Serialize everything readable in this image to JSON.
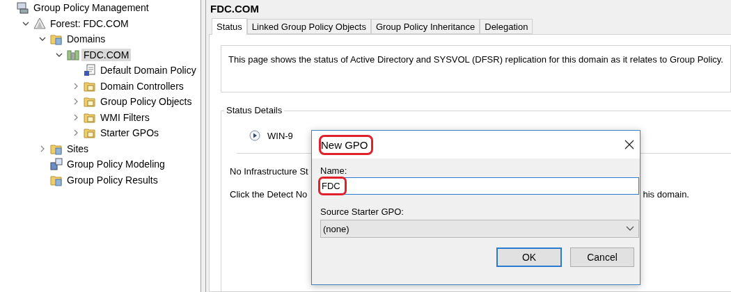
{
  "tree": [
    {
      "label": "Group Policy Management",
      "kind": "console",
      "selected": false,
      "children": [
        {
          "label": "Forest: FDC.COM",
          "kind": "forest",
          "selected": false,
          "expanded": true,
          "children": [
            {
              "label": "Domains",
              "kind": "container",
              "selected": false,
              "expanded": true,
              "children": [
                {
                  "label": "FDC.COM",
                  "kind": "domain",
                  "selected": true,
                  "expanded": true,
                  "children": [
                    {
                      "label": "Default Domain Policy",
                      "kind": "policy",
                      "selected": false
                    },
                    {
                      "label": "Domain Controllers",
                      "kind": "folder",
                      "selected": false,
                      "expanded": false
                    },
                    {
                      "label": "Group Policy Objects",
                      "kind": "folder",
                      "selected": false,
                      "expanded": false
                    },
                    {
                      "label": "WMI Filters",
                      "kind": "folder",
                      "selected": false,
                      "expanded": false
                    },
                    {
                      "label": "Starter GPOs",
                      "kind": "folder",
                      "selected": false,
                      "expanded": false
                    }
                  ]
                }
              ]
            },
            {
              "label": "Sites",
              "kind": "container",
              "selected": false,
              "expanded": false
            },
            {
              "label": "Group Policy Modeling",
              "kind": "modeling",
              "selected": false
            },
            {
              "label": "Group Policy Results",
              "kind": "container",
              "selected": false
            }
          ]
        }
      ]
    }
  ],
  "pane": {
    "title": "FDC.COM",
    "tabs": [
      {
        "label": "Status",
        "selected": true
      },
      {
        "label": "Linked Group Policy Objects",
        "selected": false
      },
      {
        "label": "Group Policy Inheritance",
        "selected": false
      },
      {
        "label": "Delegation",
        "selected": false
      }
    ],
    "description": "This page shows the status of Active Directory and SYSVOL (DFSR) replication for this domain as it relates to Group Policy.",
    "status_details": {
      "label": "Status Details",
      "server": "WIN-9",
      "infrastructure": "No Infrastructure St",
      "detect_left": "Click the Detect No",
      "detect_right": "his domain."
    }
  },
  "dialog": {
    "title": "New GPO",
    "title_highlighted": true,
    "name_label": "Name:",
    "name_value": "FDC",
    "name_highlighted": true,
    "starter_label": "Source Starter GPO:",
    "starter_value": "(none)",
    "buttons": [
      {
        "label": "OK",
        "default": true
      },
      {
        "label": "Cancel",
        "default": false
      }
    ]
  }
}
